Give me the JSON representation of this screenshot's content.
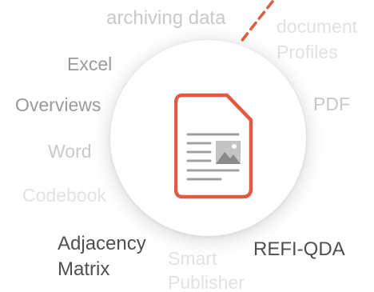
{
  "diagram": {
    "icon": "document-image-icon",
    "accent_color": "#e05a44",
    "icon_line_color": "#9e9e9e",
    "labels": {
      "archiving_data": "archiving data",
      "document": "document",
      "profiles": "Profiles",
      "excel": "Excel",
      "pdf": "PDF",
      "overviews": "Overviews",
      "word": "Word",
      "codebook": "Codebook",
      "adjacency": "Adjacency",
      "matrix": "Matrix",
      "smart": "Smart",
      "publisher": "Publisher",
      "refi_qda": "REFI-QDA"
    }
  }
}
